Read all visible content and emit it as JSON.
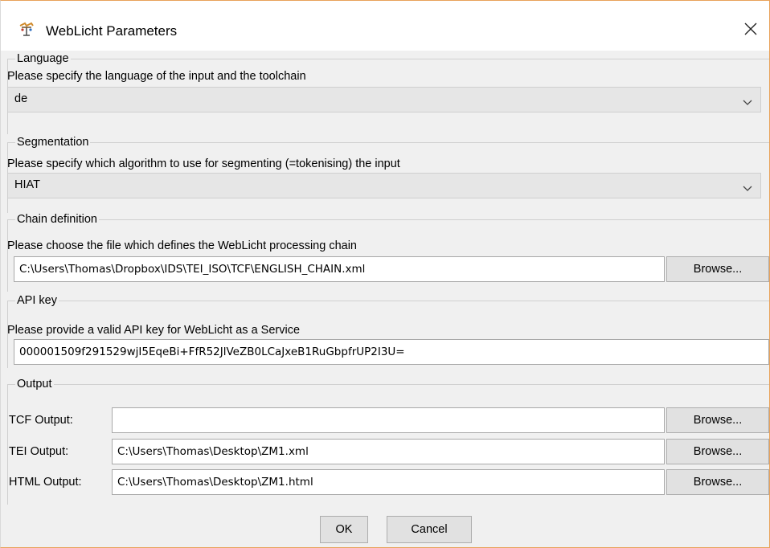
{
  "window": {
    "title": "WebLicht Parameters",
    "close_glyph": "✕"
  },
  "language": {
    "group_title": "Language",
    "description": "Please specify the language of the input and the toolchain",
    "selected": "de"
  },
  "segmentation": {
    "group_title": "Segmentation",
    "description": "Please specify which algorithm to use for segmenting (=tokenising) the input",
    "selected": "HIAT"
  },
  "chain": {
    "group_title": "Chain definition",
    "description": "Please choose the file which defines the WebLicht processing chain",
    "path": "C:\\Users\\Thomas\\Dropbox\\IDS\\TEI_ISO\\TCF\\ENGLISH_CHAIN.xml",
    "browse_label": "Browse..."
  },
  "api": {
    "group_title": "API key",
    "description": "Please provide a valid API key for WebLicht as a Service",
    "key": "000001509f291529wjI5EqeBi+FfR52JlVeZB0LCaJxeB1RuGbpfrUP2I3U="
  },
  "output": {
    "group_title": "Output",
    "tcf_label": "TCF Output:",
    "tcf_value": "",
    "tei_label": "TEI Output:",
    "tei_value": "C:\\Users\\Thomas\\Desktop\\ZM1.xml",
    "html_label": "HTML Output:",
    "html_value": "C:\\Users\\Thomas\\Desktop\\ZM1.html",
    "browse_label": "Browse..."
  },
  "footer": {
    "ok_label": "OK",
    "cancel_label": "Cancel"
  },
  "colors": {
    "window_border": "#e8a25a",
    "panel_bg": "#f0f0f0"
  },
  "icons": {
    "app": "weblicht-app-icon",
    "close": "close-icon",
    "dropdown": "chevron-down-icon"
  }
}
